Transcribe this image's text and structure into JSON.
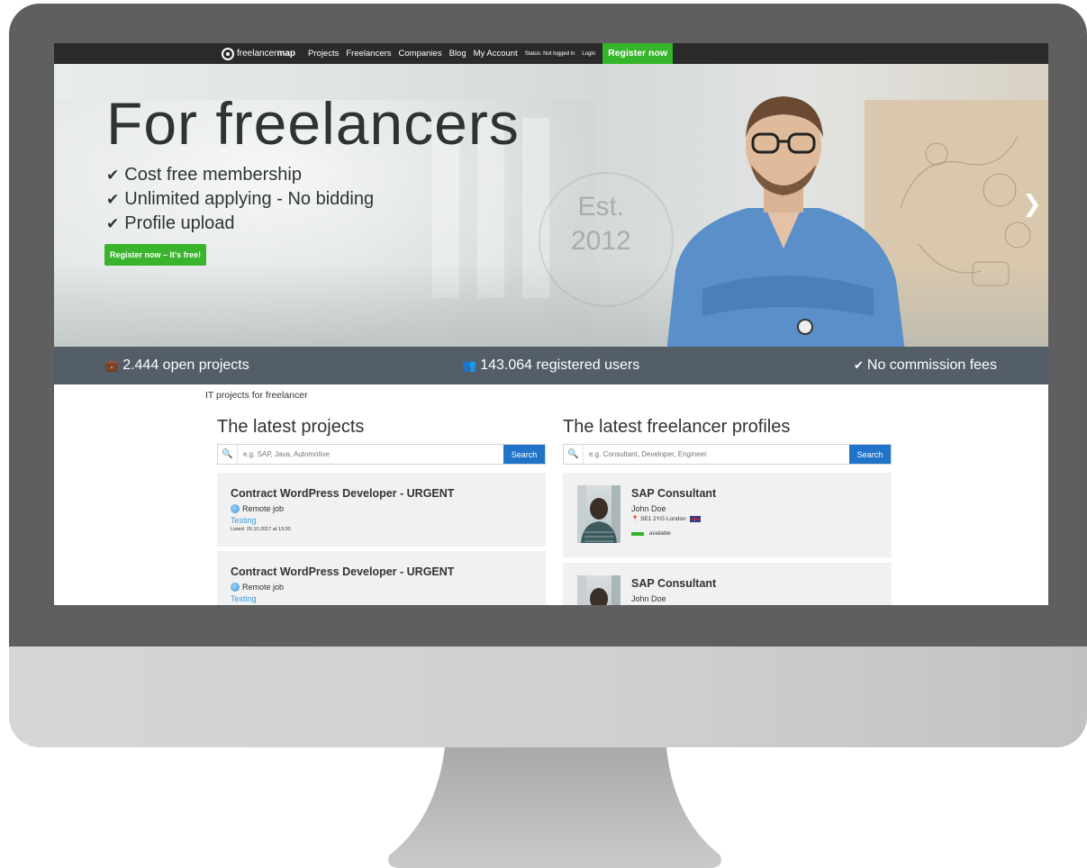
{
  "nav": {
    "logo_prefix": "freelancer",
    "logo_bold": "map",
    "items": [
      "Projects",
      "Freelancers",
      "Companies",
      "Blog",
      "My Account"
    ],
    "status": "Status: Not logged in",
    "login": "Login",
    "register": "Register now"
  },
  "hero": {
    "title": "For freelancers",
    "bullets": [
      "Cost free membership",
      "Unlimited applying - No bidding",
      "Profile upload"
    ],
    "cta": "Register now – It's free!",
    "badge_line1": "Est.",
    "badge_line2": "2012",
    "next_icon": "chevron-right-icon"
  },
  "stats": {
    "projects": "2.444 open projects",
    "users": "143.064 registered users",
    "fees": "No commission fees"
  },
  "breadcrumb": "IT projects for freelancer",
  "projects": {
    "title": "The latest projects",
    "search_placeholder": "e.g. SAP, Java, Automotive",
    "search_button": "Search",
    "items": [
      {
        "title": "Contract WordPress Developer - URGENT",
        "location": "Remote job",
        "tag": "Testing",
        "listed": "Listed: 20.10.2017 at 13:30"
      },
      {
        "title": "Contract WordPress Developer - URGENT",
        "location": "Remote job",
        "tag": "Testing",
        "listed": ""
      }
    ]
  },
  "profiles": {
    "title": "The latest freelancer profiles",
    "search_placeholder": "e.g. Consultant, Developer, Engineer",
    "search_button": "Search",
    "items": [
      {
        "title": "SAP Consultant",
        "name": "John Doe",
        "location": "SE1 2YG London",
        "status": "available"
      },
      {
        "title": "SAP Consultant",
        "name": "John Doe",
        "location": "",
        "status": ""
      }
    ]
  }
}
